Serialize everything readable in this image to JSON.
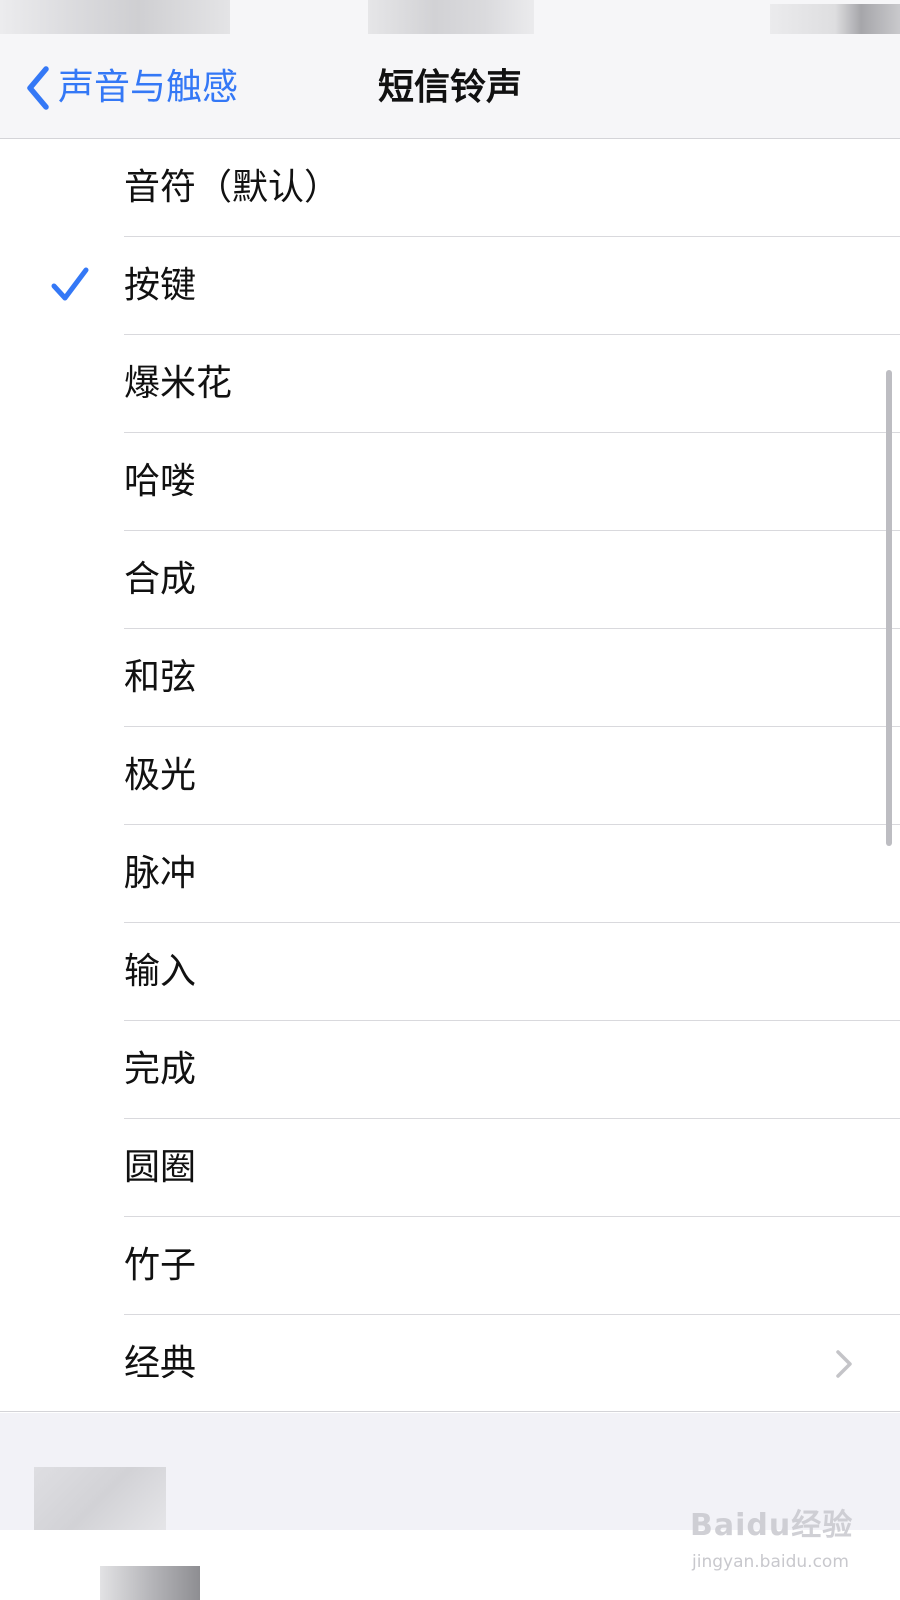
{
  "nav": {
    "back_label": "声音与触感",
    "title": "短信铃声"
  },
  "tones": {
    "items": [
      {
        "label": "音符（默认）",
        "selected": false
      },
      {
        "label": "按键",
        "selected": true
      },
      {
        "label": "爆米花",
        "selected": false
      },
      {
        "label": "哈喽",
        "selected": false
      },
      {
        "label": "合成",
        "selected": false
      },
      {
        "label": "和弦",
        "selected": false
      },
      {
        "label": "极光",
        "selected": false
      },
      {
        "label": "脉冲",
        "selected": false
      },
      {
        "label": "输入",
        "selected": false
      },
      {
        "label": "完成",
        "selected": false
      },
      {
        "label": "圆圈",
        "selected": false
      },
      {
        "label": "竹子",
        "selected": false
      },
      {
        "label": "经典",
        "selected": false,
        "has_disclosure": true
      }
    ]
  },
  "watermark": {
    "logo_text": "Baidu经验",
    "url": "jingyan.baidu.com"
  },
  "colors": {
    "accent": "#3478f6",
    "background": "#f2f2f7"
  },
  "icons": {
    "back": "chevron-left-icon",
    "selected": "checkmark-icon",
    "disclosure": "chevron-right-icon"
  }
}
